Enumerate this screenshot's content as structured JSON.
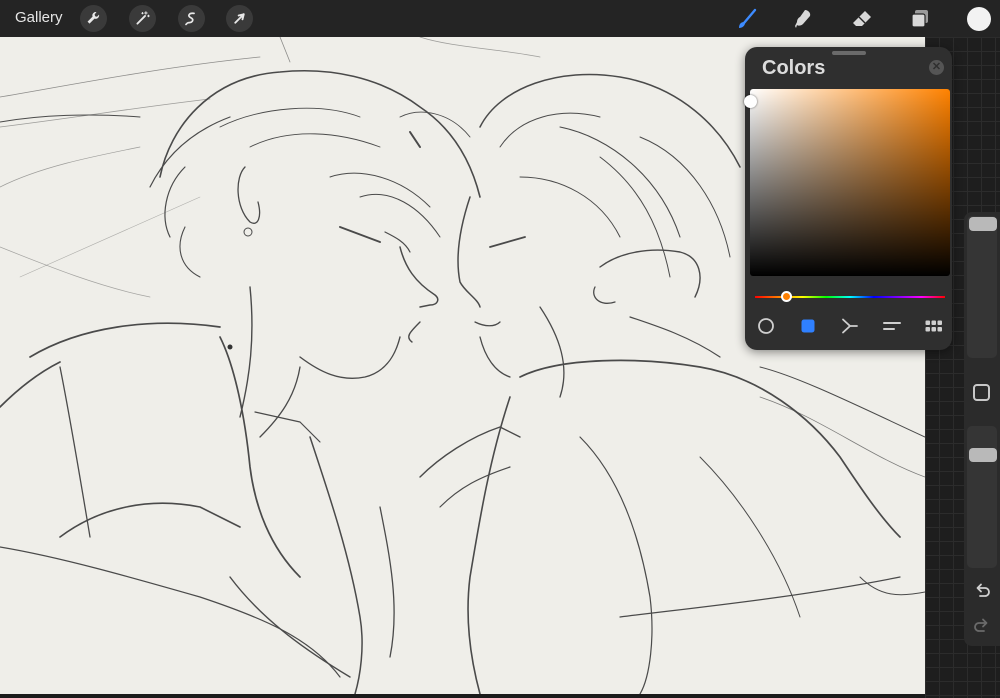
{
  "toolbar": {
    "gallery_label": "Gallery",
    "left_tools": [
      "wrench-icon",
      "magic-wand-icon",
      "selection-icon",
      "transform-arrow-icon"
    ],
    "right_tools": [
      "brush-icon",
      "smudge-icon",
      "eraser-icon",
      "layers-icon"
    ],
    "active_tool": "brush-icon",
    "active_tool_color": "#3d8bff",
    "current_color": "#f2f2f2"
  },
  "colors_panel": {
    "title": "Colors",
    "hue_color": "#ff8200",
    "tabs": [
      "disc-icon",
      "classic-icon",
      "harmony-icon",
      "value-icon",
      "palettes-icon"
    ],
    "active_tab": "classic-icon"
  },
  "sidebar": {
    "buttons": [
      "modify-icon",
      "undo-icon",
      "redo-icon"
    ]
  }
}
